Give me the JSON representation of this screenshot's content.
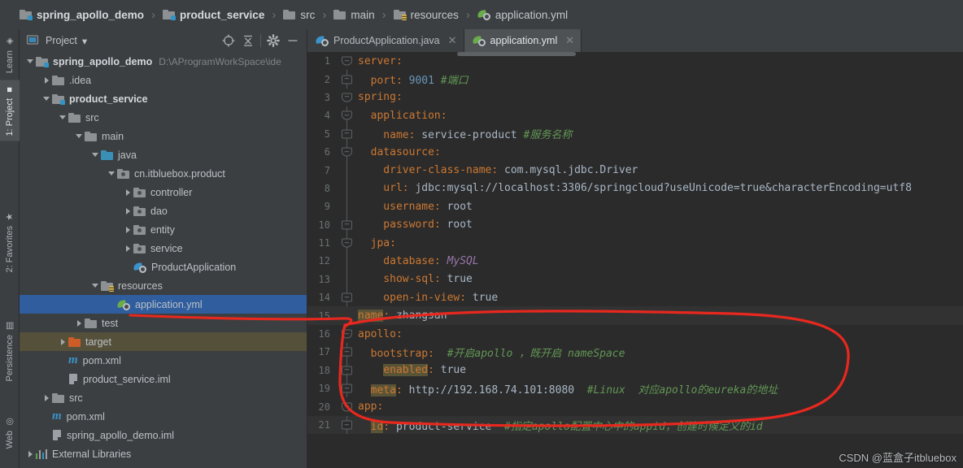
{
  "breadcrumb": {
    "items": [
      {
        "label": "spring_apollo_demo",
        "icon": "module-folder-icon",
        "bold": true
      },
      {
        "label": "product_service",
        "icon": "module-folder-icon",
        "bold": true
      },
      {
        "label": "src",
        "icon": "folder-icon",
        "bold": false
      },
      {
        "label": "main",
        "icon": "folder-icon",
        "bold": false
      },
      {
        "label": "resources",
        "icon": "resources-folder-icon",
        "bold": false
      },
      {
        "label": "application.yml",
        "icon": "yaml-file-icon",
        "bold": false
      }
    ],
    "separator": "›"
  },
  "left_toolbar": {
    "tabs": [
      {
        "label": "Learn",
        "icon": "learn-icon",
        "active": false
      },
      {
        "label": "1: Project",
        "icon": "project-icon",
        "active": true
      },
      {
        "label": "2: Favorites",
        "icon": "star-icon",
        "active": false
      },
      {
        "label": "Persistence",
        "icon": "persistence-icon",
        "active": false
      },
      {
        "label": "Web",
        "icon": "web-globe-icon",
        "active": false
      }
    ]
  },
  "project_panel": {
    "title": "Project",
    "dropdown_caret": "▾",
    "toolbar_icons": [
      {
        "name": "locate-file-icon"
      },
      {
        "name": "collapse-all-icon"
      },
      {
        "name": "gear-icon"
      },
      {
        "name": "hide-panel-icon"
      }
    ],
    "tree": [
      {
        "label": "spring_apollo_demo",
        "path": "D:\\AProgramWorkSpace\\ide",
        "indent": 0,
        "twisty": "down",
        "icon": "module-folder-icon",
        "bold": true,
        "state": "none"
      },
      {
        "label": ".idea",
        "path": "",
        "indent": 1,
        "twisty": "right",
        "icon": "folder-icon",
        "bold": false,
        "state": "none"
      },
      {
        "label": "product_service",
        "path": "",
        "indent": 1,
        "twisty": "down",
        "icon": "module-folder-icon",
        "bold": true,
        "state": "none"
      },
      {
        "label": "src",
        "path": "",
        "indent": 2,
        "twisty": "down",
        "icon": "folder-icon",
        "bold": false,
        "state": "none"
      },
      {
        "label": "main",
        "path": "",
        "indent": 3,
        "twisty": "down",
        "icon": "folder-icon",
        "bold": false,
        "state": "none"
      },
      {
        "label": "java",
        "path": "",
        "indent": 4,
        "twisty": "down",
        "icon": "source-folder-icon",
        "bold": false,
        "state": "none"
      },
      {
        "label": "cn.itbluebox.product",
        "path": "",
        "indent": 5,
        "twisty": "down",
        "icon": "package-icon",
        "bold": false,
        "state": "none"
      },
      {
        "label": "controller",
        "path": "",
        "indent": 6,
        "twisty": "right",
        "icon": "package-icon",
        "bold": false,
        "state": "none"
      },
      {
        "label": "dao",
        "path": "",
        "indent": 6,
        "twisty": "right",
        "icon": "package-icon",
        "bold": false,
        "state": "none"
      },
      {
        "label": "entity",
        "path": "",
        "indent": 6,
        "twisty": "right",
        "icon": "package-icon",
        "bold": false,
        "state": "none"
      },
      {
        "label": "service",
        "path": "",
        "indent": 6,
        "twisty": "right",
        "icon": "package-icon",
        "bold": false,
        "state": "none"
      },
      {
        "label": "ProductApplication",
        "path": "",
        "indent": 6,
        "twisty": "none",
        "icon": "spring-class-icon",
        "bold": false,
        "state": "none"
      },
      {
        "label": "resources",
        "path": "",
        "indent": 4,
        "twisty": "down",
        "icon": "resources-folder-icon",
        "bold": false,
        "state": "none"
      },
      {
        "label": "application.yml",
        "path": "",
        "indent": 5,
        "twisty": "none",
        "icon": "yaml-file-icon",
        "bold": false,
        "state": "selected"
      },
      {
        "label": "test",
        "path": "",
        "indent": 3,
        "twisty": "right",
        "icon": "folder-icon",
        "bold": false,
        "state": "none"
      },
      {
        "label": "target",
        "path": "",
        "indent": 2,
        "twisty": "right",
        "icon": "target-folder-icon",
        "bold": false,
        "state": "highlighted"
      },
      {
        "label": "pom.xml",
        "path": "",
        "indent": 2,
        "twisty": "none",
        "icon": "maven-icon",
        "bold": false,
        "state": "none"
      },
      {
        "label": "product_service.iml",
        "path": "",
        "indent": 2,
        "twisty": "none",
        "icon": "iml-file-icon",
        "bold": false,
        "state": "none"
      },
      {
        "label": "src",
        "path": "",
        "indent": 1,
        "twisty": "right",
        "icon": "folder-icon",
        "bold": false,
        "state": "none"
      },
      {
        "label": "pom.xml",
        "path": "",
        "indent": 1,
        "twisty": "none",
        "icon": "maven-icon",
        "bold": false,
        "state": "none"
      },
      {
        "label": "spring_apollo_demo.iml",
        "path": "",
        "indent": 1,
        "twisty": "none",
        "icon": "iml-file-icon",
        "bold": false,
        "state": "none"
      },
      {
        "label": "External Libraries",
        "path": "",
        "indent": 0,
        "twisty": "right",
        "icon": "libraries-icon",
        "bold": false,
        "state": "none"
      }
    ]
  },
  "editor": {
    "tabs": [
      {
        "label": "ProductApplication.java",
        "icon": "spring-class-icon",
        "active": false,
        "close": "✕"
      },
      {
        "label": "application.yml",
        "icon": "yaml-file-icon",
        "active": true,
        "close": "✕"
      }
    ],
    "lines": [
      {
        "n": "1",
        "fold": "tri",
        "foldline": false,
        "highlight": false,
        "parts": [
          {
            "t": "server:",
            "c": "k"
          }
        ],
        "indent": 0
      },
      {
        "n": "2",
        "fold": "flat",
        "foldline": true,
        "highlight": false,
        "parts": [
          {
            "t": "  port:",
            "c": "k"
          },
          {
            "t": " ",
            "c": "v"
          },
          {
            "t": "9001",
            "c": "num"
          },
          {
            "t": " ",
            "c": "v"
          },
          {
            "t": "#端口",
            "c": "cm"
          }
        ],
        "indent": 0
      },
      {
        "n": "3",
        "fold": "tri",
        "foldline": false,
        "highlight": false,
        "parts": [
          {
            "t": "spring:",
            "c": "k"
          }
        ],
        "indent": 0
      },
      {
        "n": "4",
        "fold": "tri",
        "foldline": true,
        "highlight": false,
        "parts": [
          {
            "t": "  application:",
            "c": "k"
          }
        ],
        "indent": 0
      },
      {
        "n": "5",
        "fold": "flat",
        "foldline": true,
        "highlight": false,
        "parts": [
          {
            "t": "    name:",
            "c": "k"
          },
          {
            "t": " service-product ",
            "c": "v"
          },
          {
            "t": "#服务名称",
            "c": "cm"
          }
        ],
        "indent": 0
      },
      {
        "n": "6",
        "fold": "tri",
        "foldline": true,
        "highlight": false,
        "parts": [
          {
            "t": "  datasource:",
            "c": "k"
          }
        ],
        "indent": 0
      },
      {
        "n": "7",
        "fold": "none",
        "foldline": true,
        "highlight": false,
        "parts": [
          {
            "t": "    driver-class-name:",
            "c": "k"
          },
          {
            "t": " com.mysql.jdbc.Driver",
            "c": "v"
          }
        ],
        "indent": 0
      },
      {
        "n": "8",
        "fold": "none",
        "foldline": true,
        "highlight": false,
        "parts": [
          {
            "t": "    url:",
            "c": "k"
          },
          {
            "t": " jdbc:mysql://localhost:3306/springcloud?useUnicode=true&characterEncoding=utf8",
            "c": "v"
          }
        ],
        "indent": 0
      },
      {
        "n": "9",
        "fold": "none",
        "foldline": true,
        "highlight": false,
        "parts": [
          {
            "t": "    username:",
            "c": "k"
          },
          {
            "t": " root",
            "c": "v"
          }
        ],
        "indent": 0
      },
      {
        "n": "10",
        "fold": "flat",
        "foldline": true,
        "highlight": false,
        "parts": [
          {
            "t": "    password:",
            "c": "k"
          },
          {
            "t": " root",
            "c": "v"
          }
        ],
        "indent": 0
      },
      {
        "n": "11",
        "fold": "tri",
        "foldline": true,
        "highlight": false,
        "parts": [
          {
            "t": "  jpa:",
            "c": "k"
          }
        ],
        "indent": 0
      },
      {
        "n": "12",
        "fold": "none",
        "foldline": true,
        "highlight": false,
        "parts": [
          {
            "t": "    database:",
            "c": "k"
          },
          {
            "t": " ",
            "c": "v"
          },
          {
            "t": "MySQL",
            "c": "enm"
          }
        ],
        "indent": 0
      },
      {
        "n": "13",
        "fold": "none",
        "foldline": true,
        "highlight": false,
        "parts": [
          {
            "t": "    show-sql:",
            "c": "k"
          },
          {
            "t": " true",
            "c": "v"
          }
        ],
        "indent": 0
      },
      {
        "n": "14",
        "fold": "flat",
        "foldline": true,
        "highlight": false,
        "parts": [
          {
            "t": "    open-in-view:",
            "c": "k"
          },
          {
            "t": " true",
            "c": "v"
          }
        ],
        "indent": 0
      },
      {
        "n": "15",
        "fold": "none",
        "foldline": false,
        "highlight": true,
        "parts": [
          {
            "t": "name",
            "c": "k hlk"
          },
          {
            "t": ":",
            "c": "k"
          },
          {
            "t": " zhangsan",
            "c": "v"
          }
        ],
        "indent": 0
      },
      {
        "n": "16",
        "fold": "tri",
        "foldline": false,
        "highlight": false,
        "parts": [
          {
            "t": "apollo:",
            "c": "k"
          }
        ],
        "indent": 0
      },
      {
        "n": "17",
        "fold": "flat",
        "foldline": true,
        "highlight": false,
        "parts": [
          {
            "t": "  bootstrap:",
            "c": "k"
          },
          {
            "t": "  ",
            "c": "v"
          },
          {
            "t": "#开启apollo ，既开启 nameSpace",
            "c": "cm"
          }
        ],
        "indent": 0
      },
      {
        "n": "18",
        "fold": "flat",
        "foldline": true,
        "highlight": false,
        "parts": [
          {
            "t": "    ",
            "c": "v"
          },
          {
            "t": "enabled",
            "c": "k hlk"
          },
          {
            "t": ":",
            "c": "k"
          },
          {
            "t": " true",
            "c": "v"
          }
        ],
        "indent": 0
      },
      {
        "n": "19",
        "fold": "flat",
        "foldline": true,
        "highlight": false,
        "parts": [
          {
            "t": "  ",
            "c": "v"
          },
          {
            "t": "meta",
            "c": "k hlk"
          },
          {
            "t": ":",
            "c": "k"
          },
          {
            "t": " http://192.168.74.101:8080",
            "c": "v"
          },
          {
            "t": "  ",
            "c": "v"
          },
          {
            "t": "#Linux  对应apollo的eureka的地址",
            "c": "cm"
          }
        ],
        "indent": 0
      },
      {
        "n": "20",
        "fold": "tri",
        "foldline": false,
        "highlight": false,
        "parts": [
          {
            "t": "app:",
            "c": "k"
          }
        ],
        "indent": 0
      },
      {
        "n": "21",
        "fold": "flat",
        "foldline": true,
        "highlight": true,
        "parts": [
          {
            "t": "  ",
            "c": "v"
          },
          {
            "t": "id",
            "c": "k hlk"
          },
          {
            "t": ":",
            "c": "k"
          },
          {
            "t": " product-service",
            "c": "v"
          },
          {
            "t": "  ",
            "c": "v"
          },
          {
            "t": "#指定apollo配置中心中的appid，创建时候定义的id",
            "c": "cm"
          }
        ],
        "indent": 0
      }
    ]
  },
  "annotation": {
    "color": "#e8281e",
    "description": "hand-drawn-red-oval-around-apollo-block"
  },
  "watermark": {
    "text": "CSDN @蓝盒子itbluebox"
  },
  "theme": {
    "background": "#3c3f41",
    "editor_background": "#2b2b2b",
    "selection_blue": "#2f5d9e",
    "key_orange": "#cc7832",
    "comment_green": "#629755",
    "number_blue": "#6897bb",
    "text_gray": "#a9b7c6"
  }
}
